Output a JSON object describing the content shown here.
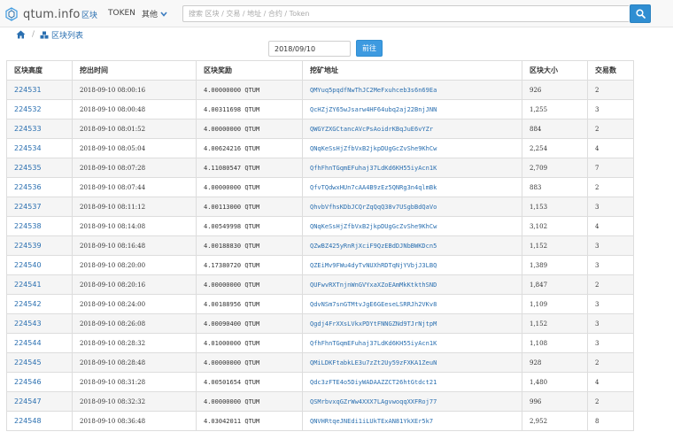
{
  "navbar": {
    "brand": "qtum.info",
    "links": [
      "区块",
      "TOKEN"
    ],
    "more_label": "其他",
    "search_placeholder": "搜索 区块 / 交易 / 地址 / 合约 / Token"
  },
  "breadcrumb": {
    "current": "区块列表"
  },
  "filter": {
    "date_value": "2018/09/10",
    "go_label": "前往"
  },
  "colors": {
    "link": "#2a6fb0",
    "button": "#2f8ed2",
    "stripe": "#f5f5f5"
  },
  "table": {
    "headers": [
      "区块高度",
      "挖出时间",
      "区块奖励",
      "挖矿地址",
      "区块大小",
      "交易数"
    ],
    "rows": [
      {
        "height": "224531",
        "time": "2018-09-10 08:00:16",
        "reward": "4.00000000 QTUM",
        "miner": "QMYuq5pqdfNwThJC2MeFxuhceb3s6n69Ea",
        "size": "926",
        "txs": "2"
      },
      {
        "height": "224532",
        "time": "2018-09-10 08:00:48",
        "reward": "4.00311698 QTUM",
        "miner": "QcHZjZY65wJsarw4HF64ubq2aj22BnjJNN",
        "size": "1,255",
        "txs": "3"
      },
      {
        "height": "224533",
        "time": "2018-09-10 08:01:52",
        "reward": "4.00000000 QTUM",
        "miner": "QWGYZXGCtancAVcPsAoidrKBqJuE6vYZr",
        "size": "884",
        "txs": "2"
      },
      {
        "height": "224534",
        "time": "2018-09-10 08:05:04",
        "reward": "4.00624216 QTUM",
        "miner": "QNqKeSsHjZfbVxB2jkpDUgGcZvShe9KhCw",
        "size": "2,254",
        "txs": "4"
      },
      {
        "height": "224535",
        "time": "2018-09-10 08:07:28",
        "reward": "4.11080547 QTUM",
        "miner": "QfhFhnTGqmEFuhaj37LdKd6KH55iyAcn1K",
        "size": "2,709",
        "txs": "7"
      },
      {
        "height": "224536",
        "time": "2018-09-10 08:07:44",
        "reward": "4.00000000 QTUM",
        "miner": "QfvTQdwxHUn7cAA4B9zEz5QNRg3n4qlmBk",
        "size": "883",
        "txs": "2"
      },
      {
        "height": "224537",
        "time": "2018-09-10 08:11:12",
        "reward": "4.00113000 QTUM",
        "miner": "QhvbVfhsKDbJCQrZqQqQ38v7USgbBdQaVo",
        "size": "1,153",
        "txs": "3"
      },
      {
        "height": "224538",
        "time": "2018-09-10 08:14:08",
        "reward": "4.00549998 QTUM",
        "miner": "QNqKeSsHjZfbVxB2jkpDUgGcZvShe9KhCw",
        "size": "3,102",
        "txs": "4"
      },
      {
        "height": "224539",
        "time": "2018-09-10 08:16:48",
        "reward": "4.00188830 QTUM",
        "miner": "QZwBZ425yRnRjXciF9QzEBdDJNbBWKDcn5",
        "size": "1,152",
        "txs": "3"
      },
      {
        "height": "224540",
        "time": "2018-09-10 08:20:00",
        "reward": "4.17380720 QTUM",
        "miner": "QZEiMv9FWu4dyTvNUXhRDTqNjYVbjJ3LBQ",
        "size": "1,389",
        "txs": "3"
      },
      {
        "height": "224541",
        "time": "2018-09-10 08:20:16",
        "reward": "4.00000000 QTUM",
        "miner": "QUFwvRXTnjnWnGVYxaXZoEAmMkKtkthSND",
        "size": "1,847",
        "txs": "2"
      },
      {
        "height": "224542",
        "time": "2018-09-10 08:24:00",
        "reward": "4.00188956 QTUM",
        "miner": "QdvNSm7snGTMtvJgE6GEeseLSRRJh2VKv8",
        "size": "1,109",
        "txs": "3"
      },
      {
        "height": "224543",
        "time": "2018-09-10 08:26:08",
        "reward": "4.00090400 QTUM",
        "miner": "Qgdj4FrXXsLVkxPDYtFNNGZNd9TJrNjtpM",
        "size": "1,152",
        "txs": "3"
      },
      {
        "height": "224544",
        "time": "2018-09-10 08:28:32",
        "reward": "4.01000000 QTUM",
        "miner": "QfhFhnTGqmEFuhaj37LdKd6KH55iyAcn1K",
        "size": "1,108",
        "txs": "3"
      },
      {
        "height": "224545",
        "time": "2018-09-10 08:28:48",
        "reward": "4.00000000 QTUM",
        "miner": "QMiLDKFtabkLE3u7zZt2Uy59zFXKA1ZeuN",
        "size": "928",
        "txs": "2"
      },
      {
        "height": "224546",
        "time": "2018-09-10 08:31:28",
        "reward": "4.00501654 QTUM",
        "miner": "Qdc3zFTE4o5DiyWADAAZZCT26htGtdct21",
        "size": "1,480",
        "txs": "4"
      },
      {
        "height": "224547",
        "time": "2018-09-10 08:32:32",
        "reward": "4.00000000 QTUM",
        "miner": "QSMrbvxqGZrWw4XXX7LAgvwoqqXXFRoj77",
        "size": "996",
        "txs": "2"
      },
      {
        "height": "224548",
        "time": "2018-09-10 08:36:48",
        "reward": "4.03042011 QTUM",
        "miner": "QNVHRtqeJNEdi1iLUkTExAN81YkXEr5k7",
        "size": "2,952",
        "txs": "8"
      }
    ]
  }
}
